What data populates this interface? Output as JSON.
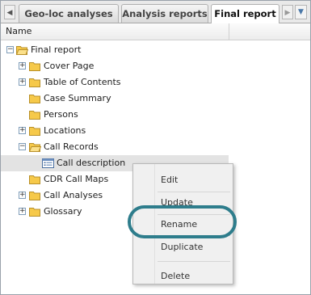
{
  "tabs": [
    {
      "label": "Geo-loc analyses",
      "active": false
    },
    {
      "label": "Analysis reports",
      "active": false
    },
    {
      "label": "Final report",
      "active": true
    }
  ],
  "column_header": {
    "name": "Name"
  },
  "tree": {
    "root": "Final report",
    "items": [
      {
        "label": "Cover Page",
        "expandable": true
      },
      {
        "label": "Table of Contents",
        "expandable": true
      },
      {
        "label": "Case Summary",
        "expandable": false
      },
      {
        "label": "Persons",
        "expandable": false
      },
      {
        "label": "Locations",
        "expandable": true
      },
      {
        "label": "Call Records",
        "expandable": true,
        "expanded": true
      },
      {
        "label": "Call description",
        "selected": true
      },
      {
        "label": "CDR Call Maps",
        "expandable": false
      },
      {
        "label": "Call Analyses",
        "expandable": true
      },
      {
        "label": "Glossary",
        "expandable": true
      }
    ]
  },
  "context_menu": {
    "items": [
      "Edit",
      "Update",
      "Rename",
      "Duplicate",
      "Delete"
    ],
    "highlighted": "Rename"
  },
  "colors": {
    "folder": "#f6c94a",
    "highlight_ring": "#2e7d8c",
    "selected_row": "#e3e3e3"
  }
}
